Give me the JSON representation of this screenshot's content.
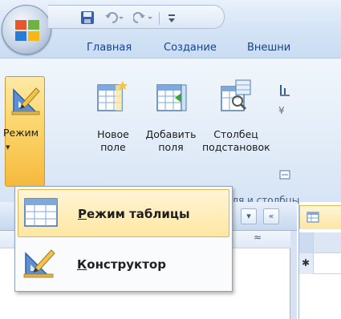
{
  "tabs": [
    {
      "label": "Главная"
    },
    {
      "label": "Создание"
    },
    {
      "label": "Внешни"
    }
  ],
  "ribbon": {
    "mode_button": {
      "label": "Режим",
      "arrow": "▾",
      "icon": "ruler-triangle-pencil-icon"
    },
    "new_field": {
      "label_line1": "Новое",
      "label_line2": "поле",
      "icon": "table-new-column-icon"
    },
    "add_fields": {
      "label_line1": "Добавить",
      "label_line2": "поля",
      "icon": "table-add-fields-icon"
    },
    "lookup_column": {
      "label_line1": "Столбец",
      "label_line2": "подстановок",
      "icon": "table-lookup-icon"
    },
    "group_label": "оля и столбцы"
  },
  "menu": {
    "items": [
      {
        "mnemonic": "Р",
        "rest": "ежим таблицы",
        "icon": "datasheet-view-icon",
        "highlighted": true
      },
      {
        "mnemonic": "К",
        "rest": "онструктор",
        "icon": "design-view-icon",
        "highlighted": false
      }
    ]
  },
  "navpane": {
    "dropdown_glyph": "▾",
    "collapse_glyph": "«",
    "section_collapse_glyph": "≈"
  },
  "doc": {
    "new_record_glyph": "✱"
  },
  "colors": {
    "ribbon_text": "#15428b",
    "highlight": "#ffe7a3",
    "mode_button": "#fbd56a"
  }
}
